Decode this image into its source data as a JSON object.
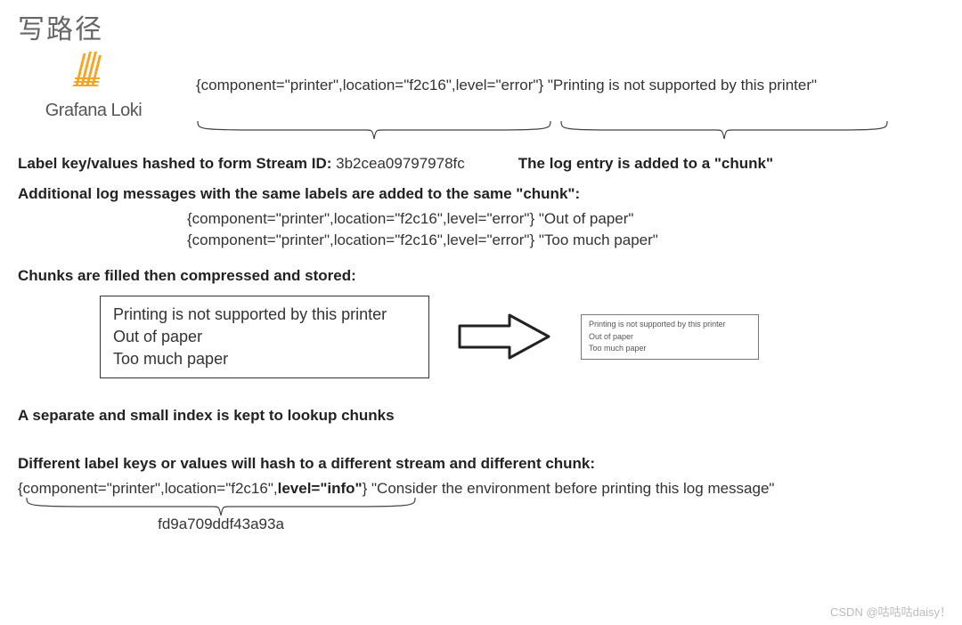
{
  "title_cn": "写路径",
  "brand": "Grafana Loki",
  "log_line1": "{component=\"printer\",location=\"f2c16\",level=\"error\"} \"Printing is not supported by this printer\"",
  "stream_line": {
    "label": "Label key/values hashed to form Stream ID:",
    "id": "3b2cea09797978fc",
    "chunk_added": "The log entry is added to a \"chunk\""
  },
  "same_chunk_header": "Additional log messages with the same labels are added to the same \"chunk\":",
  "same_chunk_logs": {
    "l1": "{component=\"printer\",location=\"f2c16\",level=\"error\"} \"Out of paper\"",
    "l2": "{component=\"printer\",location=\"f2c16\",level=\"error\"} \"Too much paper\""
  },
  "compress_header": "Chunks are filled then compressed and stored:",
  "box_big": {
    "a": "Printing is not supported by this printer",
    "b": "Out of paper",
    "c": "Too much paper"
  },
  "box_small": {
    "a": "Printing is not supported by this printer",
    "b": "Out of paper",
    "c": "Too much paper"
  },
  "index_line": "A separate and small index is kept to lookup chunks",
  "diff_header": "Different label keys or values will hash to a different stream and different chunk:",
  "diff_log_pre": "{component=\"printer\",location=\"f2c16\",",
  "diff_log_bold": "level=\"info\"",
  "diff_log_post": "} \"Consider the environment before printing this log message\"",
  "diff_hash": "fd9a709ddf43a93a",
  "watermark": "CSDN @咕咕咕daisy！"
}
